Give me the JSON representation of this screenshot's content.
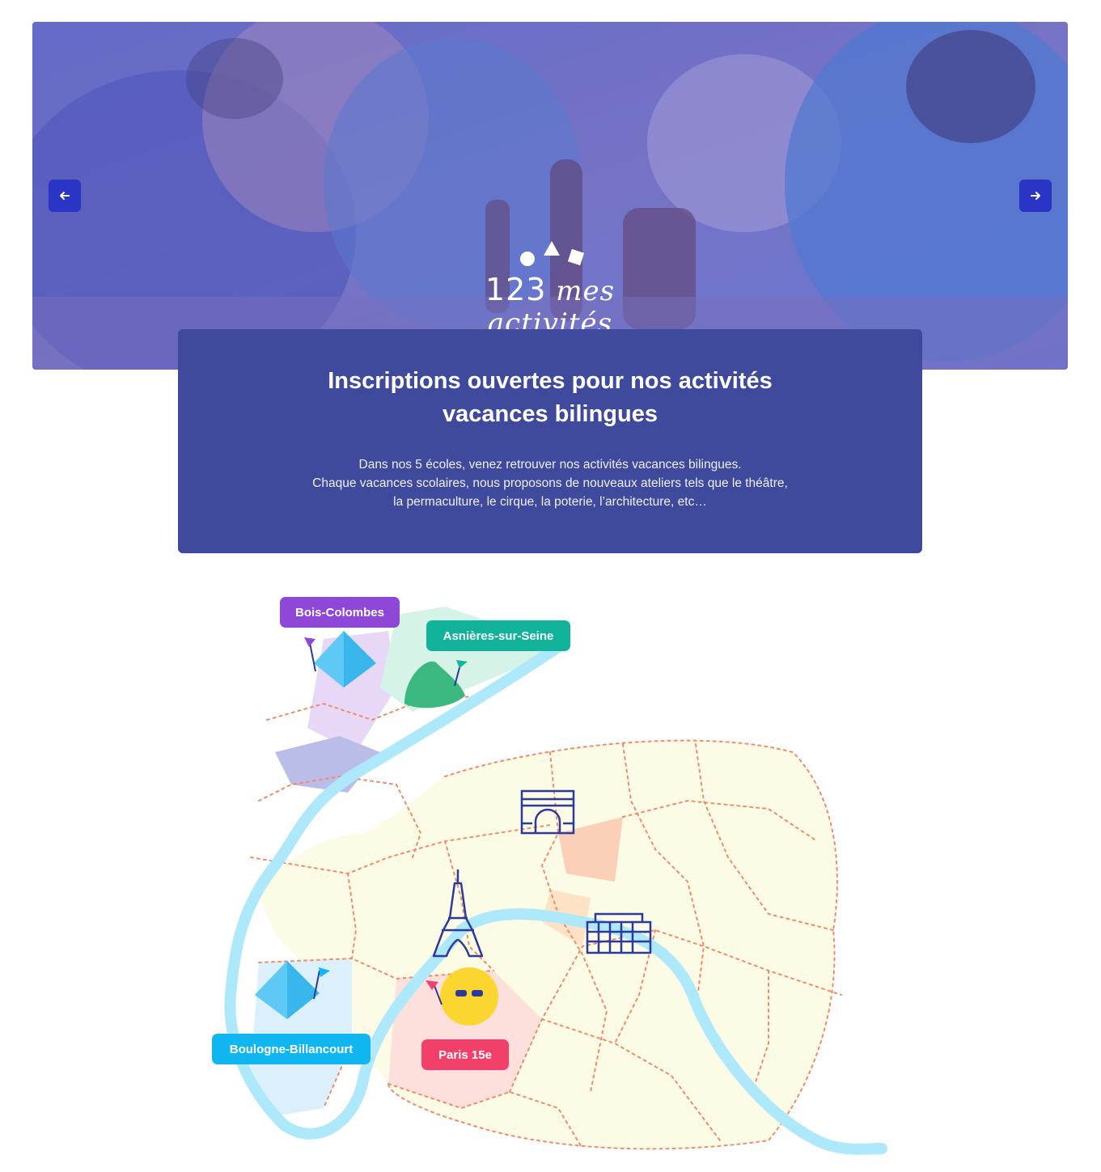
{
  "hero": {
    "prev_label": "previous",
    "next_label": "next",
    "logo": {
      "number": "123",
      "text": "mes activités"
    }
  },
  "card": {
    "title": "Inscriptions ouvertes pour nos activités vacances bilingues",
    "body_lines": [
      "Dans nos 5 écoles, venez retrouver nos activités vacances bilingues.",
      "Chaque vacances scolaires, nous proposons de nouveaux ateliers tels que le théâtre,",
      "la permaculture, le cirque, la poterie, l’architecture, etc…"
    ]
  },
  "map": {
    "locations": [
      {
        "name": "Bois-Colombes",
        "color": "#8f47d8"
      },
      {
        "name": "Asnières-sur-Seine",
        "color": "#12b39b"
      },
      {
        "name": "Boulogne-Billancourt",
        "color": "#10b6f0"
      },
      {
        "name": "Paris 15e",
        "color": "#f2406a"
      }
    ],
    "landmark_icons": [
      "arc-de-triomphe-icon",
      "eiffel-tower-icon",
      "opera-icon"
    ],
    "river_color": "#aee8fb",
    "border_color": "#f4896a"
  },
  "colors": {
    "card_bg": "#3f4a9c",
    "nav_button": "#2b35c5"
  }
}
